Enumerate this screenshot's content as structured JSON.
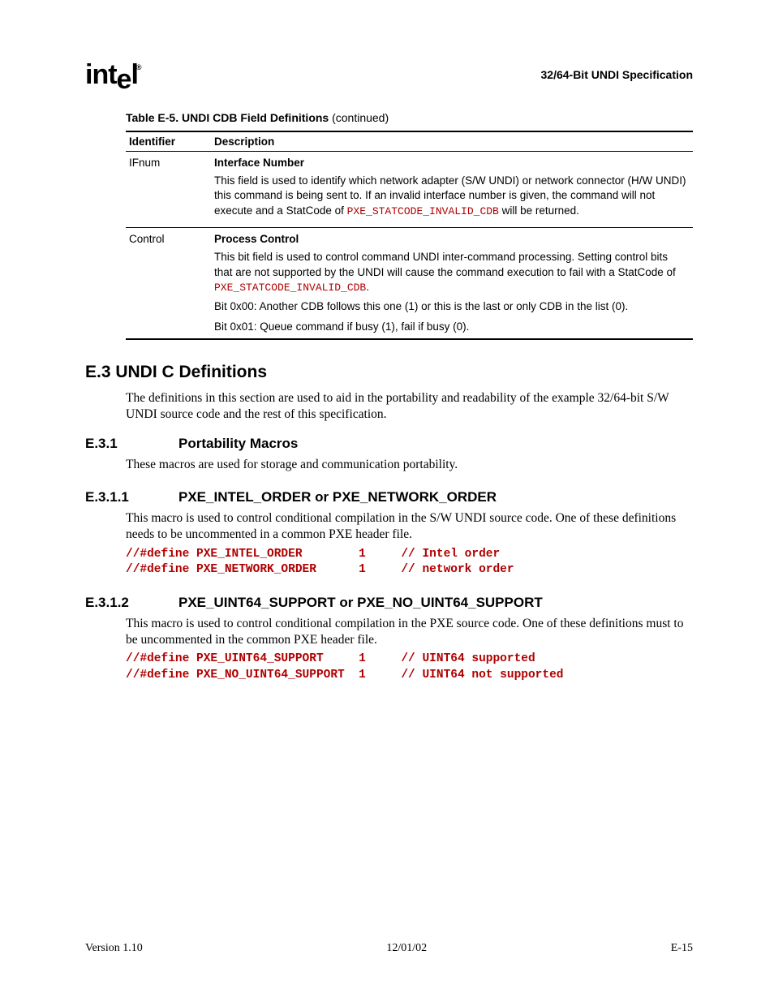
{
  "header": {
    "logo_text": "intel",
    "doc_title": "32/64-Bit UNDI Specification"
  },
  "table": {
    "caption_bold": "Table E-5.  UNDI CDB Field Definitions ",
    "caption_cont": "(continued)",
    "headers": [
      "Identifier",
      "Description"
    ],
    "rows": [
      {
        "identifier": "IFnum",
        "desc_title": "Interface Number",
        "desc_body_pre": "This field is used to identify which network adapter (S/W UNDI) or network connector (H/W UNDI) this command is being sent to.  If an invalid interface number is given, the command will not execute and a StatCode of ",
        "desc_code": "PXE_STATCODE_INVALID_CDB",
        "desc_body_post": " will be returned."
      },
      {
        "identifier": "Control",
        "desc_title": "Process Control",
        "desc_body_pre": "This bit field is used to control command UNDI inter-command processing.  Setting control bits that are not supported by the UNDI will cause the command execution to fail with a StatCode of ",
        "desc_code": "PXE_STATCODE_INVALID_CDB",
        "desc_body_post": ".",
        "extra_1": "Bit 0x00:  Another CDB follows this one (1) or this is the last or only CDB in the list (0).",
        "extra_2": "Bit 0x01:  Queue command if busy (1), fail if busy (0)."
      }
    ]
  },
  "sections": {
    "e3": {
      "heading": "E.3  UNDI C Definitions",
      "body": "The definitions in this section are used to aid in the portability and readability of the example 32/64-bit S/W UNDI source code and the rest of this specification."
    },
    "e3_1": {
      "num": "E.3.1",
      "title": "Portability Macros",
      "body": "These macros are used for storage and communication portability."
    },
    "e3_1_1": {
      "num": "E.3.1.1",
      "title": "PXE_INTEL_ORDER or PXE_NETWORK_ORDER",
      "body": "This macro is used to control conditional compilation in the S/W UNDI source code.  One of these definitions needs to be uncommented in a common PXE header file.",
      "code": "//#define PXE_INTEL_ORDER        1     // Intel order\n//#define PXE_NETWORK_ORDER      1     // network order"
    },
    "e3_1_2": {
      "num": "E.3.1.2",
      "title": "PXE_UINT64_SUPPORT or PXE_NO_UINT64_SUPPORT",
      "body": "This macro is used to control conditional compilation in the PXE source code.  One of these definitions must to be uncommented in the common PXE header file.",
      "code": "//#define PXE_UINT64_SUPPORT     1     // UINT64 supported\n//#define PXE_NO_UINT64_SUPPORT  1     // UINT64 not supported"
    }
  },
  "footer": {
    "version": "Version 1.10",
    "date": "12/01/02",
    "page": "E-15"
  }
}
